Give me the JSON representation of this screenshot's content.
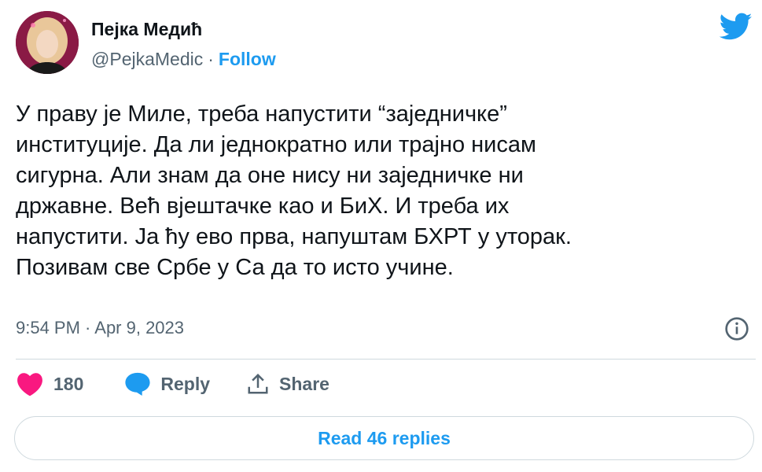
{
  "author": {
    "name": "Пејка Медић",
    "handle": "@PejkaMedic",
    "separator": "·",
    "follow_label": "Follow",
    "avatar_icon": "profile-photo"
  },
  "brand": {
    "icon": "twitter-bird-icon",
    "color": "#1d9bf0"
  },
  "tweet": {
    "lines": [
      "У праву је Миле, треба напустити “заједничке”",
      "институције. Да ли једнократно или трајно нисам",
      "сигурна. Али знам да оне нису ни заједничке ни",
      "државне. Већ вјештачке као и БиХ. И треба их",
      "напустити. Ја ћу ево прва, напуштам БХРТ у уторак.",
      "Позивам све Србе у Са да то исто учине."
    ],
    "timestamp": "9:54 PM · Apr 9, 2023"
  },
  "actions": {
    "like_count": "180",
    "reply_label": "Reply",
    "share_label": "Share",
    "like_color": "#f91880"
  },
  "footer": {
    "read_replies_label": "Read 46 replies"
  }
}
